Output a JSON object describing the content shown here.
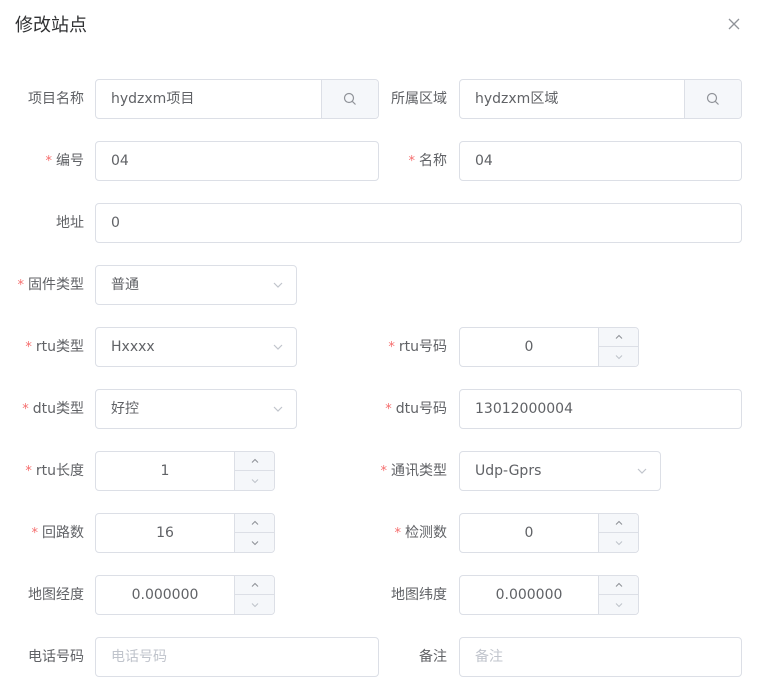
{
  "dialog": {
    "title": "修改站点"
  },
  "fields": {
    "project": {
      "label": "项目名称",
      "value": "hydzxm项目"
    },
    "area": {
      "label": "所属区域",
      "value": "hydzxm区域"
    },
    "code": {
      "label": "编号",
      "value": "04",
      "required": "*"
    },
    "name": {
      "label": "名称",
      "value": "04",
      "required": "*"
    },
    "address": {
      "label": "地址",
      "value": "0"
    },
    "firmware_type": {
      "label": "固件类型",
      "value": "普通",
      "required": "*"
    },
    "rtu_type": {
      "label": "rtu类型",
      "value": "Hxxxx",
      "required": "*"
    },
    "rtu_code": {
      "label": "rtu号码",
      "value": "0",
      "required": "*"
    },
    "dtu_type": {
      "label": "dtu类型",
      "value": "好控",
      "required": "*"
    },
    "dtu_code": {
      "label": "dtu号码",
      "value": "13012000004",
      "required": "*"
    },
    "rtu_length": {
      "label": "rtu长度",
      "value": "1",
      "required": "*"
    },
    "comm_type": {
      "label": "通讯类型",
      "value": "Udp-Gprs",
      "required": "*"
    },
    "loops": {
      "label": "回路数",
      "value": "16",
      "required": "*"
    },
    "detections": {
      "label": "检测数",
      "value": "0",
      "required": "*"
    },
    "longitude": {
      "label": "地图经度",
      "value": "0.000000"
    },
    "latitude": {
      "label": "地图纬度",
      "value": "0.000000"
    },
    "phone": {
      "label": "电话号码",
      "value": "",
      "placeholder": "电话号码"
    },
    "remark": {
      "label": "备注",
      "value": "",
      "placeholder": "备注"
    }
  },
  "icons": {
    "close": "close-icon",
    "search": "search-icon",
    "caret": "chevron-down-icon",
    "spin_up": "chevron-up-icon",
    "spin_down": "chevron-down-icon"
  },
  "colors": {
    "required": "#f56c6c",
    "border": "#dcdfe6",
    "append_bg": "#f5f7fa",
    "placeholder": "#c0c4cc",
    "text": "#606266",
    "title": "#303133"
  }
}
